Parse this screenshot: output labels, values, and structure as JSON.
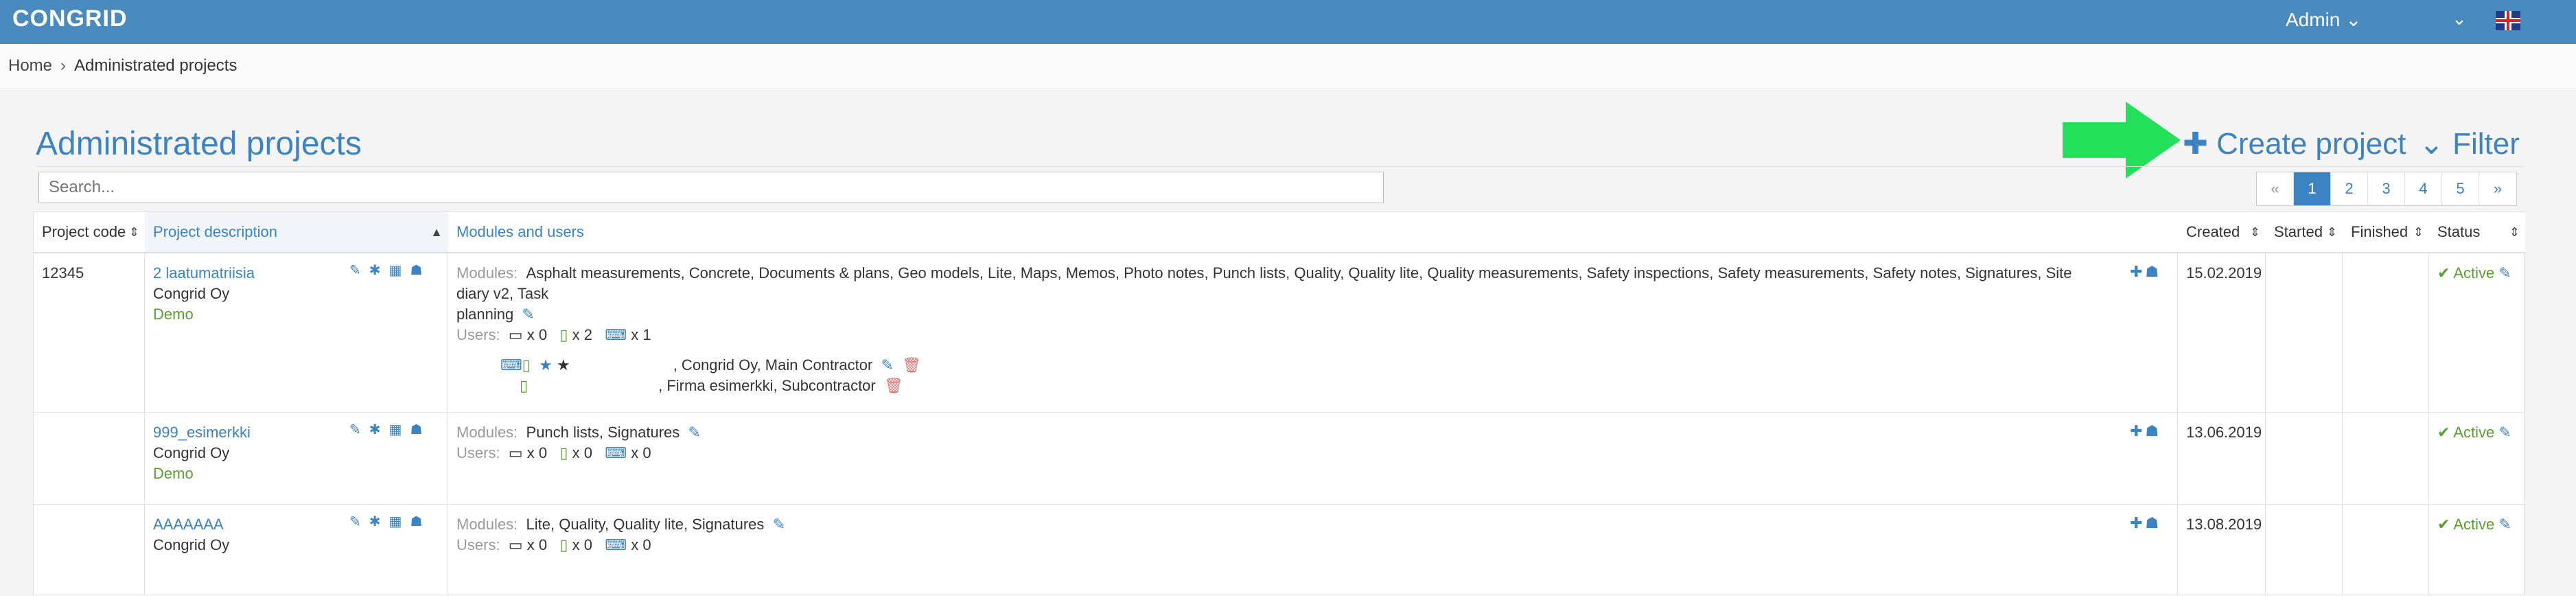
{
  "app": {
    "logo": "CONGRID",
    "admin_label": "Admin ⌄",
    "dropdown_caret": "⌄"
  },
  "breadcrumb": {
    "home": "Home",
    "separator": "›",
    "current": "Administrated projects"
  },
  "page": {
    "title": "Administrated projects",
    "create_label": "Create project",
    "filter_label": "Filter",
    "search_placeholder": "Search..."
  },
  "pagination": {
    "prev": "«",
    "pages": [
      "1",
      "2",
      "3",
      "4",
      "5"
    ],
    "active_page": "1",
    "next": "»"
  },
  "table": {
    "headers": {
      "code": "Project code",
      "description": "Project description",
      "modules": "Modules and users",
      "created": "Created",
      "started": "Started",
      "finished": "Finished",
      "status": "Status"
    },
    "modules_label": "Modules:",
    "users_label": "Users:",
    "rows": [
      {
        "code": "12345",
        "name": "2 laatumatriisia",
        "company": "Congrid Oy",
        "tag": "Demo",
        "modules": "Asphalt measurements, Concrete, Documents & plans, Geo models, Lite, Maps, Memos, Photo notes, Punch lists, Quality, Quality lite, Quality measurements, Safety inspections, Safety measurements, Safety notes, Signatures, Site diary v2, Task",
        "modules_cont": "planning",
        "users": {
          "card": "x 0",
          "mobile": "x 2",
          "laptop": "x 1"
        },
        "members": [
          {
            "text": ", Congrid Oy, Main Contractor"
          },
          {
            "text": ", Firma esimerkki, Subcontractor"
          }
        ],
        "created": "15.02.2019",
        "status": "Active"
      },
      {
        "code": "",
        "name": "999_esimerkki",
        "company": "Congrid Oy",
        "tag": "Demo",
        "modules": "Punch lists, Signatures",
        "users": {
          "card": "x 0",
          "mobile": "x 0",
          "laptop": "x 0"
        },
        "created": "13.06.2019",
        "status": "Active"
      },
      {
        "code": "",
        "name": "AAAAAAA",
        "company": "Congrid Oy",
        "tag": "",
        "modules": "Lite, Quality, Quality lite, Signatures",
        "users": {
          "card": "x 0",
          "mobile": "x 0",
          "laptop": "x 0"
        },
        "created": "13.08.2019",
        "status": "Active"
      }
    ]
  },
  "colors": {
    "topbar": "#4a8bbf",
    "accent": "#3b83c2",
    "success": "#5a9e2f",
    "danger": "#e46a6a",
    "arrow": "#22e05a"
  },
  "icons": {
    "edit": "pencil-icon",
    "settings": "gear-icon",
    "calendar": "calendar-icon",
    "users": "users-icon",
    "add_user": "add-user-icon",
    "check": "check-icon",
    "trash": "trash-icon",
    "card": "card-icon",
    "mobile": "mobile-icon",
    "laptop": "laptop-icon"
  }
}
